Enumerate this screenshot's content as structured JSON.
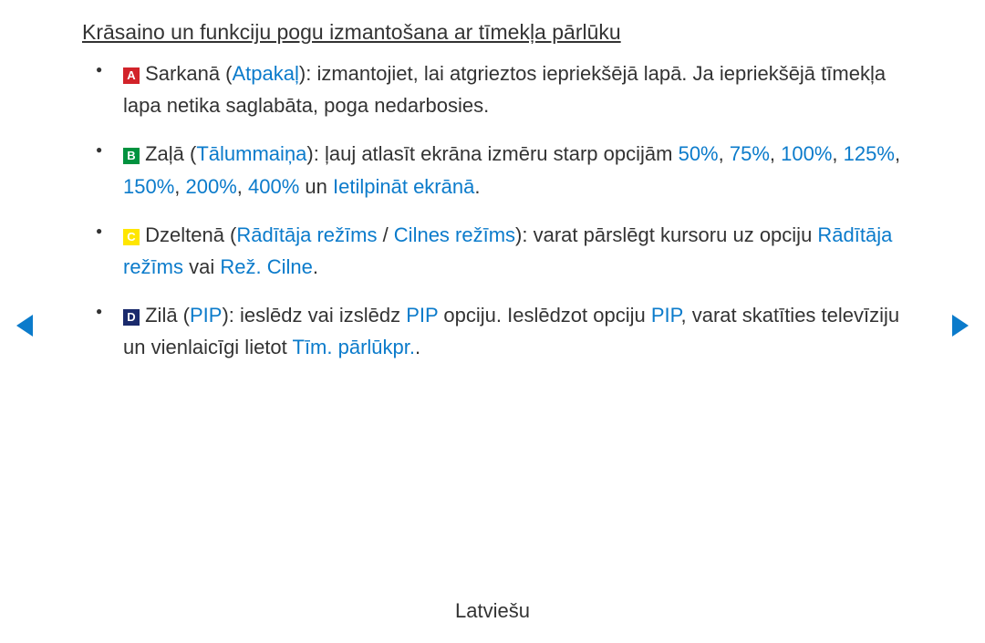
{
  "title": "Krāsaino un funkciju pogu izmantošana ar tīmekļa pārlūku",
  "items": {
    "a": {
      "letter": "A",
      "pre": " Sarkanā (",
      "label": "Atpakaļ",
      "post": "): izmantojiet, lai atgrieztos iepriekšējā lapā. Ja iepriekšējā tīmekļa lapa netika saglabāta, poga nedarbosies."
    },
    "b": {
      "letter": "B",
      "pre": " Zaļā (",
      "label": "Tālummaiņa",
      "mid": "): ļauj atlasīt ekrāna izmēru starp opcijām ",
      "p50": "50%",
      "c1": ", ",
      "p75": "75%",
      "c2": ", ",
      "p100": "100%",
      "c3": ", ",
      "p125": "125%",
      "c4": ", ",
      "p150": "150%",
      "c5": ", ",
      "p200": "200%",
      "c6": ", ",
      "p400": "400%",
      "and": " un ",
      "fit": "Ietilpināt ekrānā",
      "end": "."
    },
    "c": {
      "letter": "C",
      "pre": " Dzeltenā (",
      "label1": "Rādītāja režīms",
      "slash": " / ",
      "label2": "Cilnes režīms",
      "mid": "): varat pārslēgt kursoru uz opciju ",
      "opt1": "Rādītāja režīms",
      "or": " vai ",
      "opt2": "Rež. Cilne",
      "end": "."
    },
    "d": {
      "letter": "D",
      "pre": " Zilā (",
      "label": "PIP",
      "mid1": "): ieslēdz vai izslēdz ",
      "pip2": "PIP",
      "mid2": " opciju. Ieslēdzot opciju ",
      "pip3": "PIP",
      "mid3": ", varat skatīties televīziju un vienlaicīgi lietot ",
      "browser": "Tīm. pārlūkpr.",
      "end": "."
    }
  },
  "footer": "Latviešu"
}
